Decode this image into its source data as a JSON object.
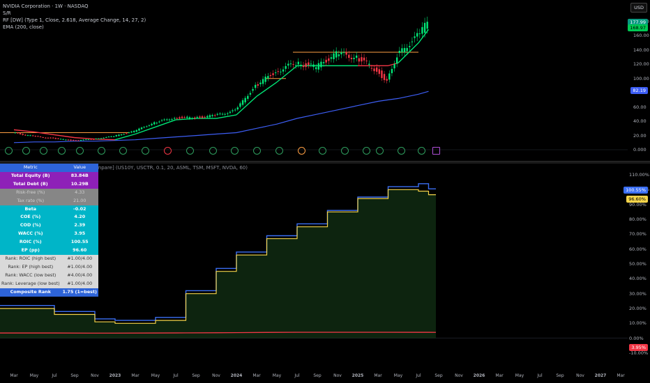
{
  "legend": {
    "title": "NVIDIA Corporation · 1W · NASDAQ",
    "line2": "S/R",
    "line3": "RF [DW] (Type 1, Close, 2.618, Average Change, 14, 27, 2)",
    "line4": "EMA (200, close)",
    "lower": "IBAC VS [Fundamental-Rated Asset Compare] (US10Y, USCTR, 0.1, 20, ASML, TSM, MSFT, NVDA, 60)"
  },
  "currency": "USD",
  "price_axis": {
    "ticks": [
      "180.00",
      "160.00",
      "140.00",
      "120.00",
      "100.00",
      "80.00",
      "60.00",
      "40.00",
      "20.00",
      "0.000"
    ]
  },
  "price_badges": {
    "last": "177.99",
    "rf": "168.97",
    "ema": "82.19"
  },
  "lower_axis": {
    "ticks": [
      "110.00%",
      "100.00%",
      "90.00%",
      "80.00%",
      "70.00%",
      "60.00%",
      "50.00%",
      "40.00%",
      "30.00%",
      "20.00%",
      "10.00%",
      "0.00%",
      "-10.00%"
    ]
  },
  "lower_badges": {
    "roic": "100.55%",
    "ep": "96.60%",
    "wacc": "3.95%"
  },
  "table": {
    "header": [
      "Metric",
      "Value"
    ],
    "rows": [
      {
        "metric": "Total Equity (B)",
        "value": "83.84B",
        "style": "pur"
      },
      {
        "metric": "Total Debt (B)",
        "value": "10.29B",
        "style": "pur"
      },
      {
        "metric": "Risk-free (%)",
        "value": "4.33",
        "style": "gry"
      },
      {
        "metric": "Tax rate (%)",
        "value": "21.00",
        "style": "gry"
      },
      {
        "metric": "Beta",
        "value": "-0.02",
        "style": "cyn"
      },
      {
        "metric": "COE (%)",
        "value": "4.20",
        "style": "cyn"
      },
      {
        "metric": "COD (%)",
        "value": "2.39",
        "style": "cyn"
      },
      {
        "metric": "WACC (%)",
        "value": "3.95",
        "style": "cyn"
      },
      {
        "metric": "ROIC (%)",
        "value": "100.55",
        "style": "cyn"
      },
      {
        "metric": "EP (pp)",
        "value": "96.60",
        "style": "cyn"
      },
      {
        "metric": "Rank: ROIC (high best)",
        "value": "#1.00/4.00",
        "style": "wht"
      },
      {
        "metric": "Rank: EP (high best)",
        "value": "#1.00/4.00",
        "style": "wht"
      },
      {
        "metric": "Rank: WACC (low best)",
        "value": "#4.00/4.00",
        "style": "wht"
      },
      {
        "metric": "Rank: Leverage (low best)",
        "value": "#1.00/4.00",
        "style": "wht"
      },
      {
        "metric": "Composite Rank",
        "value": "1.75 (1=best)",
        "style": "blu"
      }
    ]
  },
  "time_axis": [
    "Mar",
    "May",
    "Jul",
    "Sep",
    "Nov",
    "2023",
    "Mar",
    "May",
    "Jul",
    "Sep",
    "Nov",
    "2024",
    "Mar",
    "May",
    "Jul",
    "Sep",
    "Nov",
    "2025",
    "Mar",
    "May",
    "Jul",
    "Sep",
    "Nov",
    "2026",
    "Mar",
    "May",
    "Jul",
    "Sep",
    "Nov",
    "2027",
    "Mar"
  ],
  "colors": {
    "up": "#00e676",
    "down": "#f23645",
    "ema": "#3d5ef5",
    "rf_up": "#00e676",
    "rf_down": "#f23645",
    "sr": "#ff9f43",
    "roic": "#3b6ff5",
    "ep": "#f5d44a",
    "wacc": "#f23645"
  },
  "chart_data": [
    {
      "type": "line",
      "title": "NVIDIA Corporation · 1W · NASDAQ",
      "ylim": [
        0,
        185
      ],
      "x": [
        "2022-03",
        "2022-05",
        "2022-07",
        "2022-09",
        "2022-11",
        "2023-01",
        "2023-03",
        "2023-05",
        "2023-07",
        "2023-09",
        "2023-11",
        "2024-01",
        "2024-03",
        "2024-05",
        "2024-07",
        "2024-09",
        "2024-11",
        "2025-01",
        "2025-03",
        "2025-04",
        "2025-05",
        "2025-07",
        "2025-08"
      ],
      "series": [
        {
          "name": "Price",
          "values": [
            24,
            19,
            16,
            13,
            15,
            19,
            26,
            38,
            45,
            45,
            48,
            55,
            90,
            110,
            122,
            116,
            135,
            130,
            112,
            96,
            132,
            160,
            178
          ]
        },
        {
          "name": "RF [DW]",
          "values": [
            28,
            25,
            21,
            17,
            15,
            14,
            22,
            32,
            42,
            44,
            44,
            49,
            75,
            95,
            118,
            118,
            118,
            118,
            118,
            118,
            122,
            150,
            169
          ]
        },
        {
          "name": "EMA (200, close)",
          "values": [
            10,
            11,
            11,
            12,
            12,
            13,
            14,
            16,
            18,
            20,
            22,
            24,
            30,
            36,
            44,
            50,
            56,
            62,
            68,
            70,
            72,
            78,
            82
          ]
        }
      ]
    },
    {
      "type": "area",
      "title": "IBAC VS [Fundamental-Rated Asset Compare] (US10Y, USCTR, 0.1, 20, ASML, TSM, MSFT, NVDA, 60)",
      "ylim": [
        -12,
        115
      ],
      "x": [
        "2022-03",
        "2022-07",
        "2022-11",
        "2023-01",
        "2023-05",
        "2023-08",
        "2023-11",
        "2024-01",
        "2024-04",
        "2024-07",
        "2024-10",
        "2025-01",
        "2025-04",
        "2025-07",
        "2025-08"
      ],
      "series": [
        {
          "name": "ROIC",
          "values": [
            22,
            18,
            13,
            12,
            14,
            32,
            47,
            58,
            69,
            77,
            86,
            95,
            102,
            104,
            100.55
          ]
        },
        {
          "name": "EP",
          "values": [
            20,
            16,
            11,
            10,
            12,
            30,
            45,
            56,
            67,
            75,
            85,
            94,
            100,
            99,
            96.6
          ]
        },
        {
          "name": "WACC",
          "values": [
            3.5,
            3.5,
            3.4,
            3.4,
            3.5,
            3.6,
            3.7,
            3.8,
            3.9,
            4,
            4,
            4,
            4,
            3.95,
            3.95
          ]
        }
      ]
    }
  ]
}
